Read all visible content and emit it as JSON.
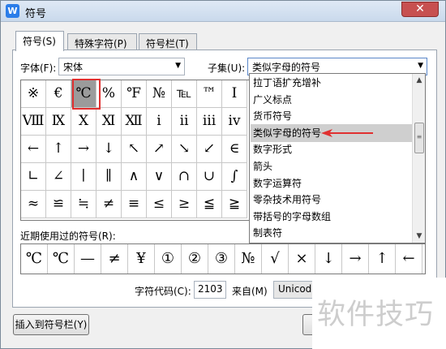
{
  "window": {
    "title": "符号",
    "app_icon": "W",
    "close": "✕"
  },
  "tabs": [
    {
      "label": "符号(S)",
      "active": true
    },
    {
      "label": "特殊字符(P)",
      "active": false
    },
    {
      "label": "符号栏(T)",
      "active": false
    }
  ],
  "font": {
    "label": "字体(F):",
    "value": "宋体"
  },
  "subset": {
    "label": "子集(U):",
    "value": "类似字母的符号"
  },
  "symbols": [
    [
      "※",
      "€",
      "℃",
      "%",
      "℉",
      "№",
      "℡",
      "™",
      "Ⅰ"
    ],
    [
      "Ⅷ",
      "Ⅸ",
      "Ⅹ",
      "Ⅺ",
      "Ⅻ",
      "ⅰ",
      "ⅱ",
      "ⅲ",
      "ⅳ"
    ],
    [
      "←",
      "↑",
      "→",
      "↓",
      "↖",
      "↗",
      "↘",
      "↙",
      "∈"
    ],
    [
      "∟",
      "∠",
      "∣",
      "∥",
      "∧",
      "∨",
      "∩",
      "∪",
      "∫"
    ],
    [
      "≈",
      "≌",
      "≒",
      "≠",
      "≡",
      "≤",
      "≥",
      "≦",
      "≧"
    ]
  ],
  "selected_symbol": "℃",
  "subset_list": [
    {
      "label": "拉丁语扩充增补",
      "selected": false
    },
    {
      "label": "广义标点",
      "selected": false
    },
    {
      "label": "货币符号",
      "selected": false
    },
    {
      "label": "类似字母的符号",
      "selected": true
    },
    {
      "label": "数字形式",
      "selected": false
    },
    {
      "label": "箭头",
      "selected": false
    },
    {
      "label": "数字运算符",
      "selected": false
    },
    {
      "label": "零杂技术用符号",
      "selected": false
    },
    {
      "label": "带括号的字母数组",
      "selected": false
    },
    {
      "label": "制表符",
      "selected": false
    }
  ],
  "recent": {
    "label": "近期使用过的符号(R):",
    "items": [
      "℃",
      "℃",
      "—",
      "≠",
      "¥",
      "①",
      "②",
      "③",
      "№",
      "√",
      "×",
      "↓",
      "→",
      "↑",
      "←"
    ]
  },
  "charcode": {
    "label": "字符代码(C):",
    "value": "2103",
    "from_label": "来自(M)",
    "from_value": "Unicode"
  },
  "buttons": {
    "insert_to_bar": "插入到符号栏(Y)"
  },
  "watermark": "软件技巧",
  "colors": {
    "highlight": "#e03030",
    "selected_cell": "#9b9b9b",
    "titlebar": "#c9d9ec"
  }
}
